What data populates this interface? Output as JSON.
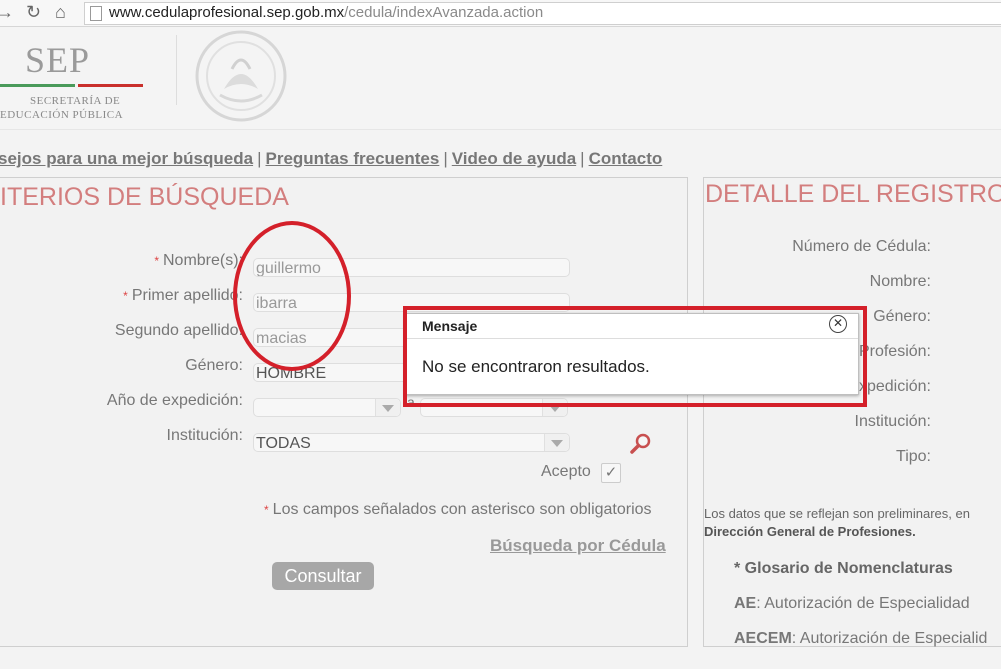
{
  "browser": {
    "url_host": "www.cedulaprofesional.sep.gob.mx",
    "url_path": "/cedula/indexAvanzada.action"
  },
  "header": {
    "logo": "SEP",
    "logo_sub1": "SECRETARÍA DE",
    "logo_sub2": "EDUCACIÓN PÚBLICA"
  },
  "links": [
    "sejos para una mejor búsqueda",
    "Preguntas frecuentes",
    "Video de ayuda",
    "Contacto"
  ],
  "search": {
    "title": "ITERIOS DE BÚSQUEDA",
    "fields": {
      "nombre_label": "Nombre(s):",
      "nombre_value": "guillermo",
      "primer_label": "Primer apellido:",
      "primer_value": "ibarra",
      "segundo_label": "Segundo apellido:",
      "segundo_value": "macias",
      "genero_label": "Género:",
      "genero_value": "HOMBRE",
      "anio_label": "Año de expedición:",
      "anio_separator": "a",
      "institucion_label": "Institución:",
      "institucion_value": "TODAS"
    },
    "acepto_label": "Acepto",
    "required_note": "Los campos señalados con asterisco son obligatorios",
    "cedula_link": "Búsqueda por Cédula",
    "consultar": "Consultar"
  },
  "detail": {
    "title": "DETALLE DEL REGISTRO",
    "labels": [
      "Número de Cédula:",
      "Nombre:",
      "Género:",
      "Profesión:",
      "Expedición:",
      "Institución:",
      "Tipo:"
    ],
    "note1": "Los datos que se reflejan son preliminares, en",
    "note2": "Dirección General de Profesiones.",
    "glosario": "* Glosario de Nomenclaturas",
    "ae_abbr": "AE",
    "ae_desc": ": Autorización de Especialidad",
    "aecem_abbr": "AECEM",
    "aecem_desc": ": Autorización de Especialid"
  },
  "dialog": {
    "title": "Mensaje",
    "message": "No se encontraron resultados."
  },
  "colors": {
    "accent_title": "#d37e7e",
    "annotation_red": "#d4202a"
  }
}
